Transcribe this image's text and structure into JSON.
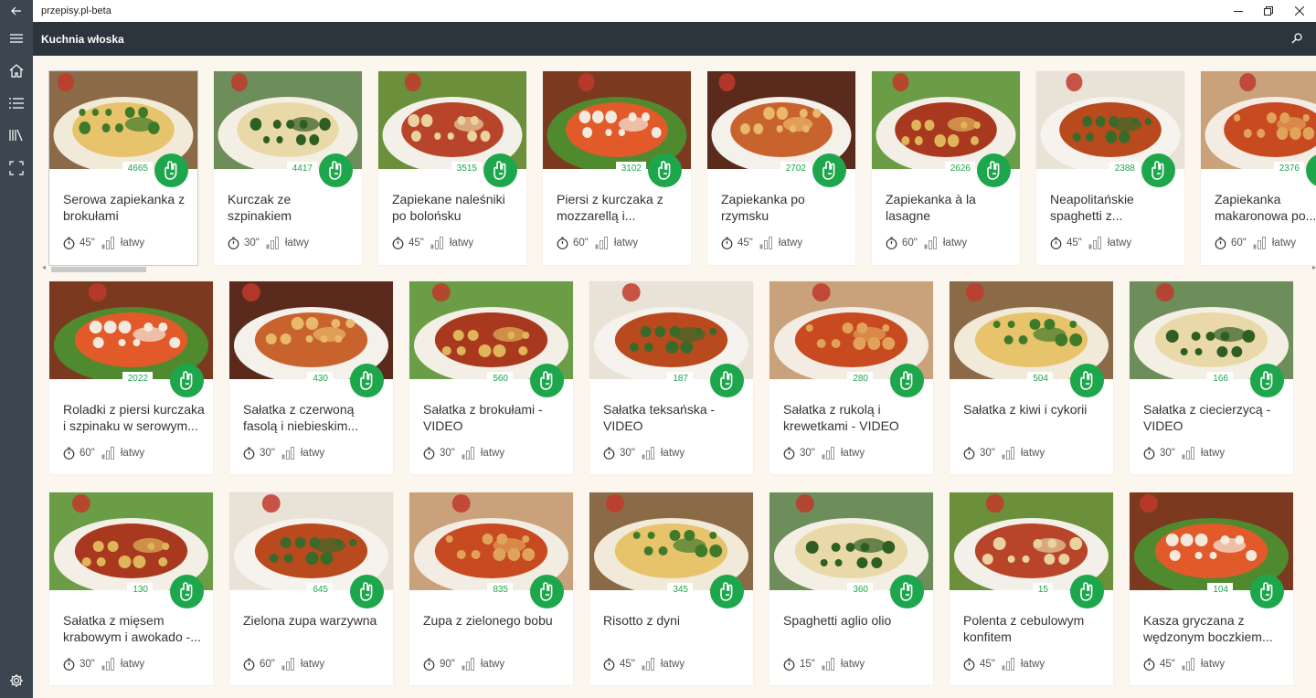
{
  "app": {
    "title": "przepisy.pl-beta"
  },
  "header": {
    "title": "Kuchnia włoska"
  },
  "colors": {
    "sidebar": "#3c4650",
    "header": "#2c353d",
    "accent": "#1ea64c",
    "background": "#fbf6ee"
  },
  "sidebar": {
    "icons": [
      "hamburger-menu-icon",
      "home-icon",
      "list-icon",
      "library-icon",
      "scan-icon",
      "gear-icon"
    ]
  },
  "row1": [
    {
      "title": "Serowa zapiekanka z brokułami",
      "count": "4665",
      "time": "45\"",
      "difficulty": "łatwy"
    },
    {
      "title": "Kurczak ze szpinakiem",
      "count": "4417",
      "time": "30\"",
      "difficulty": "łatwy"
    },
    {
      "title": "Zapiekane naleśniki po bolońsku",
      "count": "3515",
      "time": "45\"",
      "difficulty": "łatwy"
    },
    {
      "title": "Piersi z kurczaka z mozzarellą i...",
      "count": "3102",
      "time": "60\"",
      "difficulty": "łatwy"
    },
    {
      "title": "Zapiekanka po rzymsku",
      "count": "2702",
      "time": "45\"",
      "difficulty": "łatwy"
    },
    {
      "title": "Zapiekanka à la lasagne",
      "count": "2626",
      "time": "60\"",
      "difficulty": "łatwy"
    },
    {
      "title": "Neapolitańskie spaghetti z...",
      "count": "2388",
      "time": "45\"",
      "difficulty": "łatwy"
    },
    {
      "title": "Zapiekanka makaronowa po...",
      "count": "2376",
      "time": "60\"",
      "difficulty": "łatwy"
    }
  ],
  "row2": [
    {
      "title": "Roladki z piersi kurczaka i szpinaku w serowym...",
      "count": "2022",
      "time": "60\"",
      "difficulty": "łatwy"
    },
    {
      "title": "Sałatka z czerwoną fasolą i niebieskim...",
      "count": "430",
      "time": "30\"",
      "difficulty": "łatwy"
    },
    {
      "title": "Sałatka z brokułami - VIDEO",
      "count": "560",
      "time": "30\"",
      "difficulty": "łatwy"
    },
    {
      "title": "Sałatka teksańska - VIDEO",
      "count": "187",
      "time": "30\"",
      "difficulty": "łatwy"
    },
    {
      "title": "Sałatka z rukolą i krewetkami - VIDEO",
      "count": "280",
      "time": "30\"",
      "difficulty": "łatwy"
    },
    {
      "title": "Sałatka z kiwi i cykorii",
      "count": "504",
      "time": "30\"",
      "difficulty": "łatwy"
    },
    {
      "title": "Sałatka z ciecierzycą - VIDEO",
      "count": "166",
      "time": "30\"",
      "difficulty": "łatwy"
    }
  ],
  "row3": [
    {
      "title": "Sałatka z mięsem krabowym i awokado -...",
      "count": "130",
      "time": "30\"",
      "difficulty": "łatwy"
    },
    {
      "title": "Zielona zupa warzywna",
      "count": "645",
      "time": "60\"",
      "difficulty": "łatwy"
    },
    {
      "title": "Zupa z zielonego bobu",
      "count": "835",
      "time": "90\"",
      "difficulty": "łatwy"
    },
    {
      "title": "Risotto z dyni",
      "count": "345",
      "time": "45\"",
      "difficulty": "łatwy"
    },
    {
      "title": "Spaghetti aglio olio",
      "count": "360",
      "time": "15\"",
      "difficulty": "łatwy"
    },
    {
      "title": "Polenta z cebulowym konfitem",
      "count": "15",
      "time": "45\"",
      "difficulty": "łatwy"
    },
    {
      "title": "Kasza gryczana z wędzonym boczkiem...",
      "count": "104",
      "time": "45\"",
      "difficulty": "łatwy"
    }
  ]
}
